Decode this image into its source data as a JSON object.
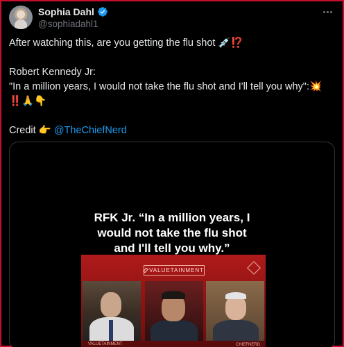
{
  "author": {
    "name": "Sophia Dahl",
    "handle": "@sophiadahl1",
    "verified": true
  },
  "icons": {
    "avatar": "avatar-photo",
    "verified": "verified-badge-icon",
    "more": "more-options-icon",
    "syringe": "syringe-icon",
    "interrobang": "interrobang-icon",
    "collision": "collision-icon",
    "double_exclamation": "double-exclamation-icon",
    "pray": "folded-hands-icon",
    "point_down": "point-down-icon",
    "point_right": "point-right-icon"
  },
  "post": {
    "line1": "After watching this, are you getting the flu shot",
    "line2": "Robert Kennedy Jr:",
    "line3": "\"In a million years, I would not take the flu shot and I'll tell you why\":",
    "credit_label": "Credit",
    "credit_link": "@TheChiefNerd"
  },
  "media": {
    "caption_line1": "RFK Jr. “In a million years, I",
    "caption_line2": "would not take the flu shot",
    "caption_line3": "and I'll tell you why.”",
    "brand": "VALUETAINMENT",
    "bottom_brand": "VALUETAINMENT",
    "bottom_credit": "CHIEFNERD"
  },
  "colors": {
    "link": "#1d9bf0",
    "verified": "#1d9bf0",
    "frame": "#c8102e",
    "video_red": "#b01a1a"
  }
}
